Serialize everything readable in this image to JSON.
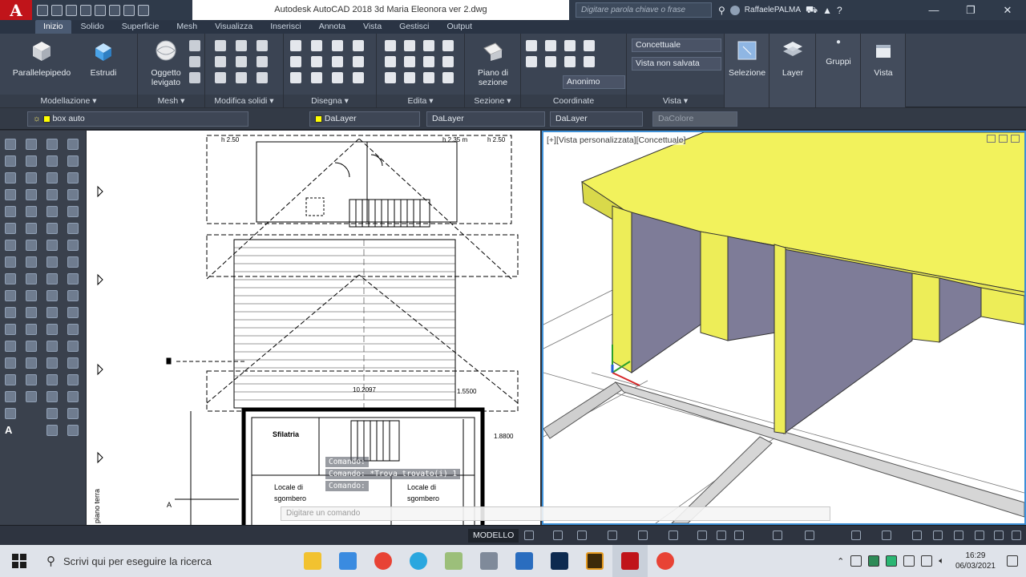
{
  "window": {
    "app_logo": "A",
    "title": "Autodesk AutoCAD 2018    3d Maria Eleonora ver 2.dwg",
    "search_placeholder": "Digitare parola chiave o frase",
    "user_name": "RaffaelePALMA",
    "help": "?",
    "minimize": "—",
    "maximize": "❐",
    "close": "✕"
  },
  "tabs": [
    {
      "label": "Inizio",
      "active": true
    },
    {
      "label": "Solido"
    },
    {
      "label": "Superficie"
    },
    {
      "label": "Mesh"
    },
    {
      "label": "Visualizza"
    },
    {
      "label": "Inserisci"
    },
    {
      "label": "Annota"
    },
    {
      "label": "Vista"
    },
    {
      "label": "Gestisci"
    },
    {
      "label": "Output"
    }
  ],
  "ribbon": {
    "modellazione": {
      "title": "Modellazione ▾",
      "parallelepipedo": "Parallelepipedo",
      "estrudi": "Estrudi",
      "oggetto_levigato_1": "Oggetto",
      "oggetto_levigato_2": "levigato"
    },
    "mesh": {
      "title": "Mesh ▾"
    },
    "modifica_solidi": {
      "title": "Modifica solidi ▾"
    },
    "disegna": {
      "title": "Disegna ▾"
    },
    "edita": {
      "title": "Edita ▾"
    },
    "sezione": {
      "title": "Sezione ▾",
      "piano_1": "Piano di",
      "piano_2": "sezione"
    },
    "coordinate": {
      "title": "Coordinate",
      "ucs_combo": "Anonimo"
    },
    "vista": {
      "title": "Vista ▾",
      "visual_style": "Concettuale",
      "saved_view": "Vista non salvata"
    },
    "selezione": "Selezione",
    "layer": "Layer",
    "gruppi": "Gruppi",
    "vista_btn": "Vista"
  },
  "properties": {
    "layer_name": "box auto",
    "color": "DaLayer",
    "linetype": "DaLayer",
    "lineweight": "DaLayer",
    "plotstyle": "DaColore"
  },
  "viewport": {
    "label": "[+][Vista personalizzata][Concettuale]"
  },
  "plan_labels": {
    "h_top_left": "h 2.50",
    "h_top_right": "h 2.35 m",
    "h_top_right2": "h 2.50",
    "dim_center": "10.2097",
    "dim_right1": "1.5500",
    "dim_right2": "1.8800",
    "room1": "Sfilatria",
    "room2": "Locale di",
    "room2b": "sgombero",
    "room3": "Locale di",
    "room3b": "sgombero",
    "side_text": "piano terra",
    "label_a": "A"
  },
  "commands": {
    "line1": "Comando:",
    "line2": "Comando:  *Trova trovato(i) 1",
    "line3": "Comando:",
    "input_placeholder": "Digitare un comando"
  },
  "statusbar": {
    "model": "MODELLO"
  },
  "taskbar": {
    "search": "Scrivi qui per eseguire la ricerca",
    "time": "16:29",
    "date": "06/03/2021"
  },
  "colors": {
    "accent_red": "#c0141a",
    "yellow_solid": "#f0f05a",
    "violet_solid": "#7e7c98",
    "viewport_border": "#3d8fd6"
  }
}
